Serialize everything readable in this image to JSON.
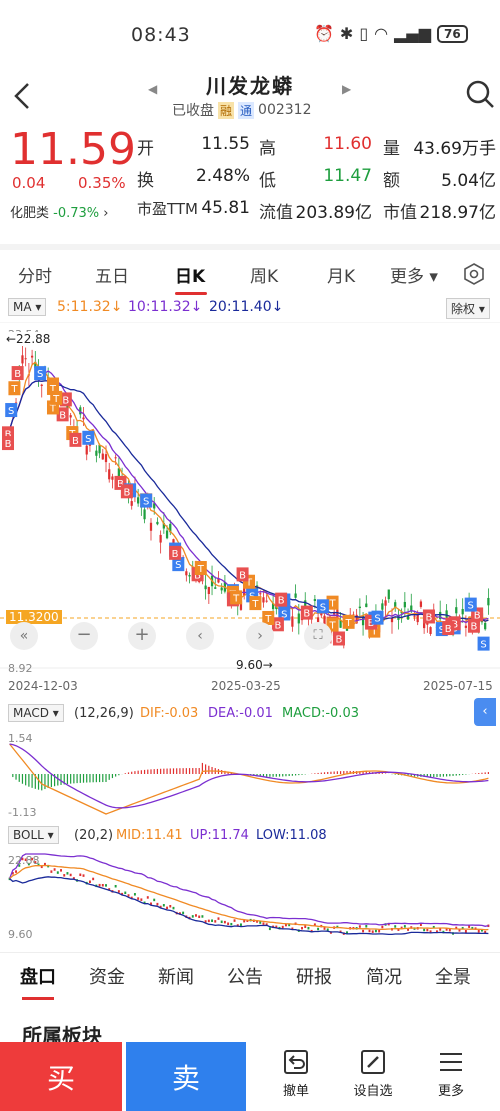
{
  "status": {
    "time": "08:43",
    "battery": "76"
  },
  "header": {
    "stock_name": "川发龙蟒",
    "market_status": "已收盘",
    "tag_rong": "融",
    "tag_tong": "通",
    "code": "002312"
  },
  "quote": {
    "price": "11.59",
    "change": "0.04",
    "change_pct": "0.35%",
    "sector_label": "化肥类",
    "sector_change": "-0.73%",
    "items": [
      {
        "k": "开",
        "v": "11.55"
      },
      {
        "k": "高",
        "v": "11.60"
      },
      {
        "k": "量",
        "v": "43.69万手"
      },
      {
        "k": "换",
        "v": "2.48%"
      },
      {
        "k": "低",
        "v": "11.47"
      },
      {
        "k": "额",
        "v": "5.04亿"
      },
      {
        "k": "市盈TTM",
        "v": "45.81"
      },
      {
        "k": "流值",
        "v": "203.89亿"
      },
      {
        "k": "市值",
        "v": "218.97亿"
      }
    ]
  },
  "ktabs": [
    "分时",
    "五日",
    "日K",
    "周K",
    "月K",
    "更多"
  ],
  "ma": {
    "label": "MA",
    "ma5": "5:11.32↓",
    "ma10": "10:11.32↓",
    "ma20": "20:11.40↓",
    "adjust": "除权"
  },
  "chart_labels": {
    "top_price": "23.54",
    "high_mark": "←22.88",
    "low_mark": "9.60→",
    "bottom_price": "8.92",
    "current_line": "11.3200",
    "dates": [
      "2024-12-03",
      "2025-03-25",
      "2025-07-15"
    ]
  },
  "macd": {
    "label": "MACD",
    "params": "(12,26,9)",
    "dif": "DIF:-0.03",
    "dea": "DEA:-0.01",
    "macd": "MACD:-0.03",
    "top": "1.54",
    "bottom": "-1.13"
  },
  "boll": {
    "label": "BOLL",
    "params": "(20,2)",
    "mid": "MID:11.41",
    "up": "UP:11.74",
    "low": "LOW:11.08",
    "top": "22.88",
    "bottom": "9.60"
  },
  "bottom_tabs": [
    "盘口",
    "资金",
    "新闻",
    "公告",
    "研报",
    "简况",
    "全景"
  ],
  "section_title": "所属板块",
  "actions": {
    "buy": "买",
    "sell": "卖",
    "cancel": "撤单",
    "watchlist": "设自选",
    "more": "更多"
  },
  "colors": {
    "up": "#e03030",
    "down": "#1e9e3e",
    "ma5": "#f08a24",
    "ma10": "#7b2fd0",
    "ma20": "#1a2a9a"
  }
}
